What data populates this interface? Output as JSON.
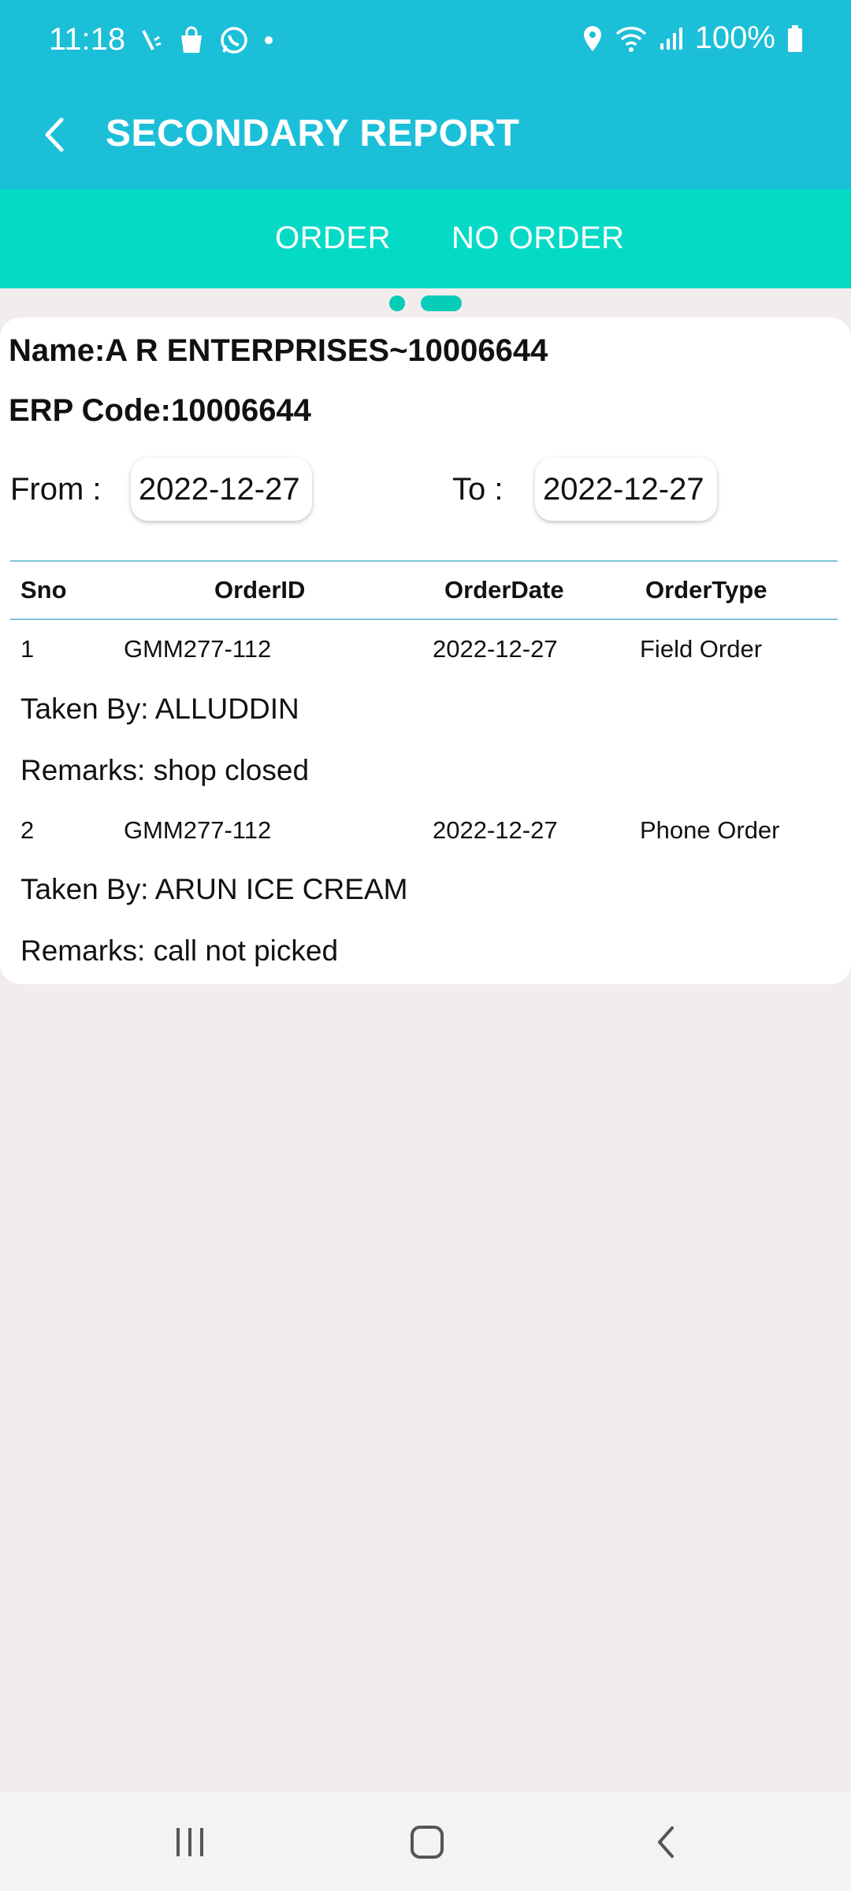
{
  "status_bar": {
    "time": "11:18",
    "battery": "100%",
    "icons": [
      "missed-call-icon",
      "shopping-bag-icon",
      "whatsapp-icon",
      "dot-icon",
      "location-icon",
      "wifi-icon",
      "signal-icon",
      "battery-icon"
    ]
  },
  "app_bar": {
    "title": "SECONDARY REPORT",
    "back_icon": "chevron-left-icon"
  },
  "tabs": [
    {
      "label": "ORDER"
    },
    {
      "label": "NO ORDER"
    }
  ],
  "page_indicator": {
    "pages": 2,
    "active": 2
  },
  "report": {
    "name_line": "Name:A R ENTERPRISES~10006644",
    "erp_line": "ERP Code:10006644",
    "from_label": "From :",
    "from_date": "2022-12-27",
    "to_label": "To :",
    "to_date": "2022-12-27"
  },
  "table": {
    "headers": [
      "Sno",
      "OrderID",
      "OrderDate",
      "OrderType"
    ],
    "rows": [
      {
        "sno": "1",
        "order_id": "GMM277-112",
        "order_date": "2022-12-27",
        "order_type": "Field Order",
        "taken_by": "Taken By: ALLUDDIN",
        "remarks": "Remarks: shop closed"
      },
      {
        "sno": "2",
        "order_id": "GMM277-112",
        "order_date": "2022-12-27",
        "order_type": "Phone Order",
        "taken_by": "Taken By: ARUN ICE CREAM",
        "remarks": "Remarks: call not picked"
      }
    ]
  },
  "nav_bar": {
    "icons": [
      "recents-icon",
      "home-icon",
      "back-icon"
    ]
  },
  "colors": {
    "app_bar": "#1cbfd8",
    "tab_bar": "#05dac6",
    "accent": "#05cdb8",
    "background": "#f3ecec"
  }
}
